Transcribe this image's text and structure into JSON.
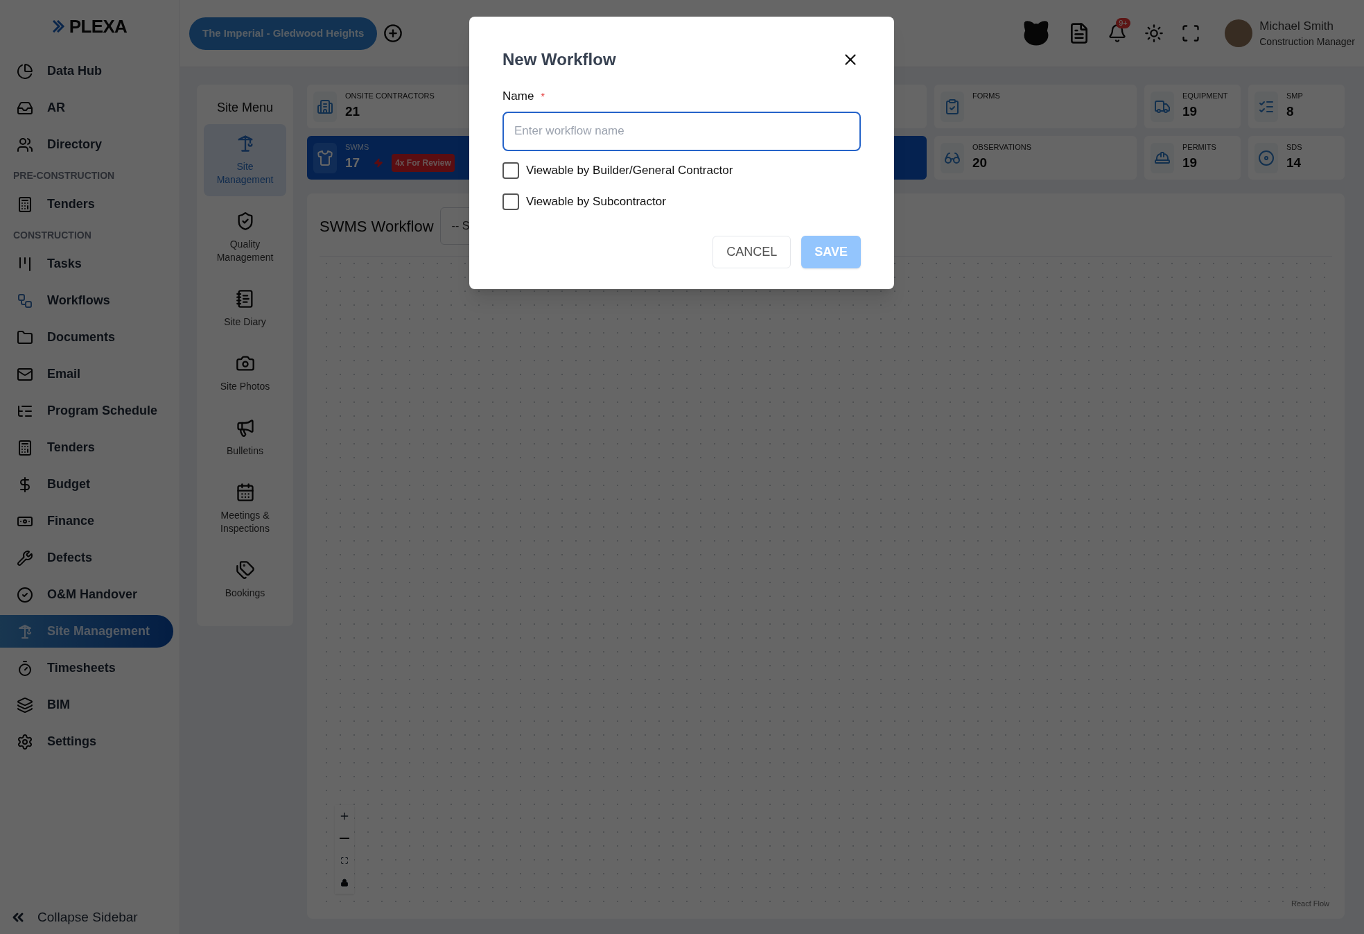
{
  "logo": {
    "text": "PLEXA"
  },
  "sidebar": {
    "items": [
      {
        "kind": "item",
        "label": "Data Hub",
        "selected": false
      },
      {
        "kind": "item",
        "label": "AR",
        "selected": false
      },
      {
        "kind": "item",
        "label": "Directory",
        "selected": false
      },
      {
        "kind": "section",
        "label": "PRE-CONSTRUCTION"
      },
      {
        "kind": "item",
        "label": "Tenders",
        "selected": false
      },
      {
        "kind": "section",
        "label": "CONSTRUCTION"
      },
      {
        "kind": "item",
        "label": "Tasks",
        "selected": false
      },
      {
        "kind": "item",
        "label": "Workflows",
        "selected": false
      },
      {
        "kind": "item",
        "label": "Documents",
        "selected": false
      },
      {
        "kind": "item",
        "label": "Email",
        "selected": false
      },
      {
        "kind": "item",
        "label": "Program Schedule",
        "selected": false
      },
      {
        "kind": "item",
        "label": "Tenders",
        "selected": false
      },
      {
        "kind": "item",
        "label": "Budget",
        "selected": false
      },
      {
        "kind": "item",
        "label": "Finance",
        "selected": false
      },
      {
        "kind": "item",
        "label": "Defects",
        "selected": false
      },
      {
        "kind": "item",
        "label": "O&M Handover",
        "selected": false
      },
      {
        "kind": "item",
        "label": "Site Management",
        "selected": true
      },
      {
        "kind": "item",
        "label": "Timesheets",
        "selected": false
      },
      {
        "kind": "item",
        "label": "BIM",
        "selected": false
      },
      {
        "kind": "item",
        "label": "Settings",
        "selected": false
      }
    ],
    "collapse": "Collapse Sidebar"
  },
  "header": {
    "project": "The Imperial - Gledwood Heights",
    "notifications_badge": "9+",
    "user": {
      "name": "Michael Smith",
      "role": "Construction Manager"
    }
  },
  "site_menu": {
    "title": "Site Menu",
    "items": [
      {
        "label": "Site Management",
        "selected": true
      },
      {
        "label": "Quality Management",
        "selected": false
      },
      {
        "label": "Site Diary",
        "selected": false
      },
      {
        "label": "Site Photos",
        "selected": false
      },
      {
        "label": "Bulletins",
        "selected": false
      },
      {
        "label": "Meetings & Inspections",
        "selected": false
      },
      {
        "label": "Bookings",
        "selected": false
      }
    ]
  },
  "stats": [
    {
      "label": "ONSITE CONTRACTORS",
      "value": "21",
      "selected": false
    },
    {
      "label": "FORMS",
      "selected": false
    },
    {
      "label": "EQUIPMENT",
      "value": "19",
      "selected": false
    },
    {
      "label": "SMP",
      "value": "8",
      "selected": false
    },
    {
      "label": "SWMS",
      "value": "17",
      "selected": true,
      "badge": "4x For Review"
    },
    {
      "label": "OBSERVATIONS",
      "value": "20",
      "selected": false
    },
    {
      "label": "PERMITS",
      "value": "19",
      "selected": false
    },
    {
      "label": "SDS",
      "value": "14",
      "selected": false
    }
  ],
  "workflow": {
    "title": "SWMS Workflow",
    "select": "-- S",
    "attribution": "React Flow"
  },
  "modal": {
    "title": "New Workflow",
    "name_label": "Name",
    "required_mark": "*",
    "placeholder": "Enter workflow name",
    "checkboxes": [
      {
        "label": "Viewable by Builder/General Contractor",
        "checked": false
      },
      {
        "label": "Viewable by Subcontractor",
        "checked": false
      }
    ],
    "cancel": "CANCEL",
    "save": "SAVE",
    "save_disabled": true
  }
}
